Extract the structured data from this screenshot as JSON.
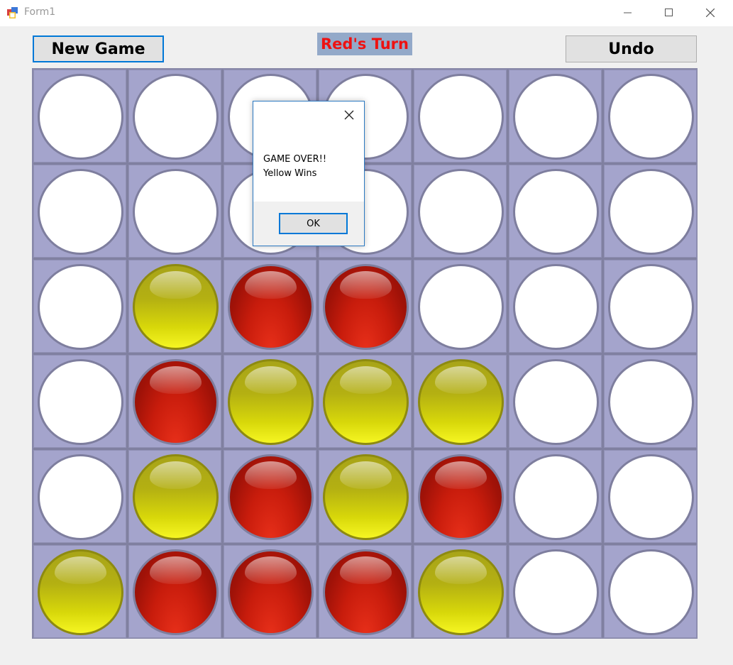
{
  "window": {
    "title": "Form1",
    "icons": {
      "app": "app-icon",
      "minimize": "minimize-icon",
      "maximize": "maximize-icon",
      "close": "close-icon"
    }
  },
  "toolbar": {
    "new_game_label": "New Game",
    "turn_label": "Red's Turn",
    "undo_label": "Undo"
  },
  "colors": {
    "turn_text": "#ee1111",
    "turn_background": "#93a9c9",
    "board_cell": "#a4a4cc",
    "red_disc": "#c81c0c",
    "yellow_disc": "#e0e010"
  },
  "board": {
    "columns": 7,
    "rows": 6,
    "cells": [
      [
        "empty",
        "empty",
        "empty",
        "empty",
        "empty",
        "empty",
        "empty"
      ],
      [
        "empty",
        "empty",
        "empty",
        "empty",
        "empty",
        "empty",
        "empty"
      ],
      [
        "empty",
        "yellow",
        "red",
        "red",
        "empty",
        "empty",
        "empty"
      ],
      [
        "empty",
        "red",
        "yellow",
        "yellow",
        "yellow",
        "empty",
        "empty"
      ],
      [
        "empty",
        "yellow",
        "red",
        "yellow",
        "red",
        "empty",
        "empty"
      ],
      [
        "yellow",
        "red",
        "red",
        "red",
        "yellow",
        "empty",
        "empty"
      ]
    ]
  },
  "dialog": {
    "line1": "GAME OVER!!",
    "line2": "Yellow Wins",
    "ok_label": "OK",
    "close_icon": "close-icon"
  }
}
